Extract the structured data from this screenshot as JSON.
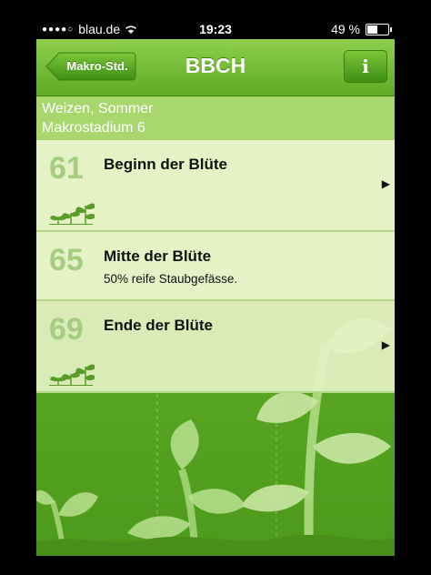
{
  "status_bar": {
    "carrier": "blau.de",
    "time": "19:23",
    "battery": "49 %",
    "battery_level": 0.49
  },
  "nav": {
    "back_label": "Makro-Std.",
    "title": "BBCH",
    "info_label": "i"
  },
  "subheader": {
    "line1": "Weizen, Sommer",
    "line2": "Makrostadium 6"
  },
  "rows": [
    {
      "code": "61",
      "title": "Beginn der Blüte",
      "description": "",
      "has_chevron": true
    },
    {
      "code": "65",
      "title": "Mitte der Blüte",
      "description": "50% reife Staubgefässe.",
      "has_chevron": false
    },
    {
      "code": "69",
      "title": "Ende der Blüte",
      "description": "",
      "has_chevron": true
    }
  ],
  "icons": [
    "wifi-icon",
    "battery-icon",
    "back-arrow-icon",
    "info-icon",
    "chevron-right-icon",
    "sprouts-icon",
    "plant-illustration"
  ],
  "colors": {
    "nav_green": "#6db52c",
    "row_bg": "#e4f2c6",
    "code_text": "#a6cc82"
  }
}
